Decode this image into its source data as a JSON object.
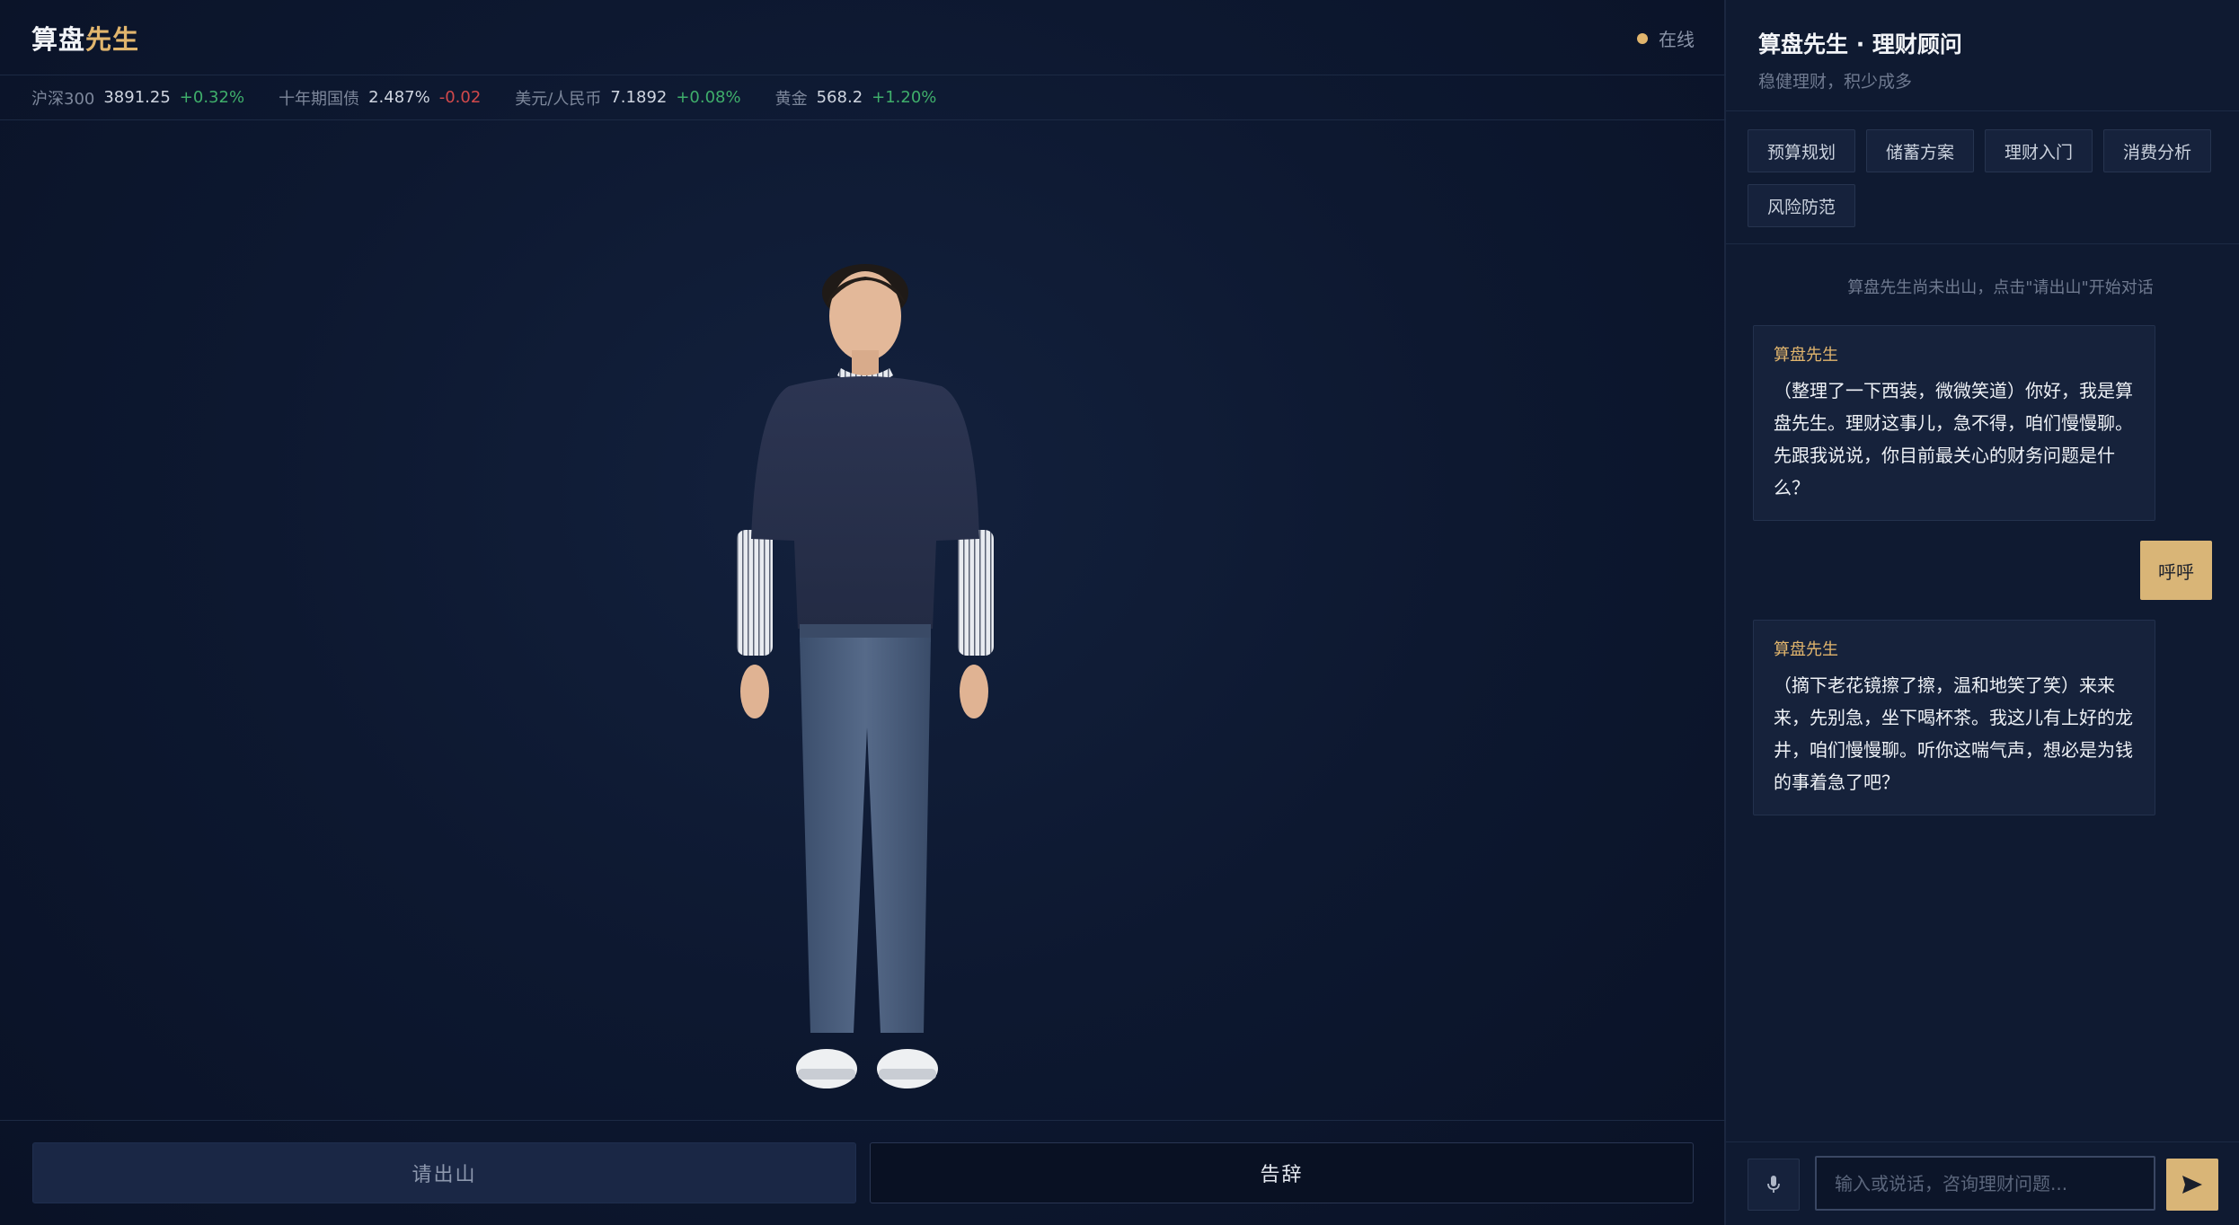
{
  "header": {
    "brand_main": "算盘",
    "brand_accent": "先生",
    "status_label": "在线"
  },
  "ticker": [
    {
      "name": "沪深300",
      "value": "3891.25",
      "change": "+0.32%",
      "direction": "up"
    },
    {
      "name": "十年期国债",
      "value": "2.487%",
      "change": "-0.02",
      "direction": "down"
    },
    {
      "name": "美元/人民币",
      "value": "7.1892",
      "change": "+0.08%",
      "direction": "up"
    },
    {
      "name": "黄金",
      "value": "568.2",
      "change": "+1.20%",
      "direction": "up"
    }
  ],
  "actions": {
    "invite_label": "请出山",
    "leave_label": "告辞"
  },
  "panel": {
    "title": "算盘先生 · 理财顾问",
    "subtitle": "稳健理财，积少成多",
    "chips": [
      "预算规划",
      "储蓄方案",
      "理财入门",
      "消费分析",
      "风险防范"
    ],
    "system_note": "算盘先生尚未出山，点击\"请出山\"开始对话",
    "messages": [
      {
        "role": "ai",
        "name": "算盘先生",
        "text": "（整理了一下西装，微微笑道）你好，我是算盘先生。理财这事儿，急不得，咱们慢慢聊。先跟我说说，你目前最关心的财务问题是什么？"
      },
      {
        "role": "user",
        "text": "呼呼"
      },
      {
        "role": "ai",
        "name": "算盘先生",
        "text": "（摘下老花镜擦了擦，温和地笑了笑）来来来，先别急，坐下喝杯茶。我这儿有上好的龙井，咱们慢慢聊。听你这喘气声，想必是为钱的事着急了吧？"
      }
    ]
  },
  "composer": {
    "placeholder": "输入或说话，咨询理财问题..."
  },
  "colors": {
    "accent": "#e1b56d",
    "user_bubble": "#d9b577",
    "up": "#3fae6b",
    "down": "#d1494b"
  }
}
